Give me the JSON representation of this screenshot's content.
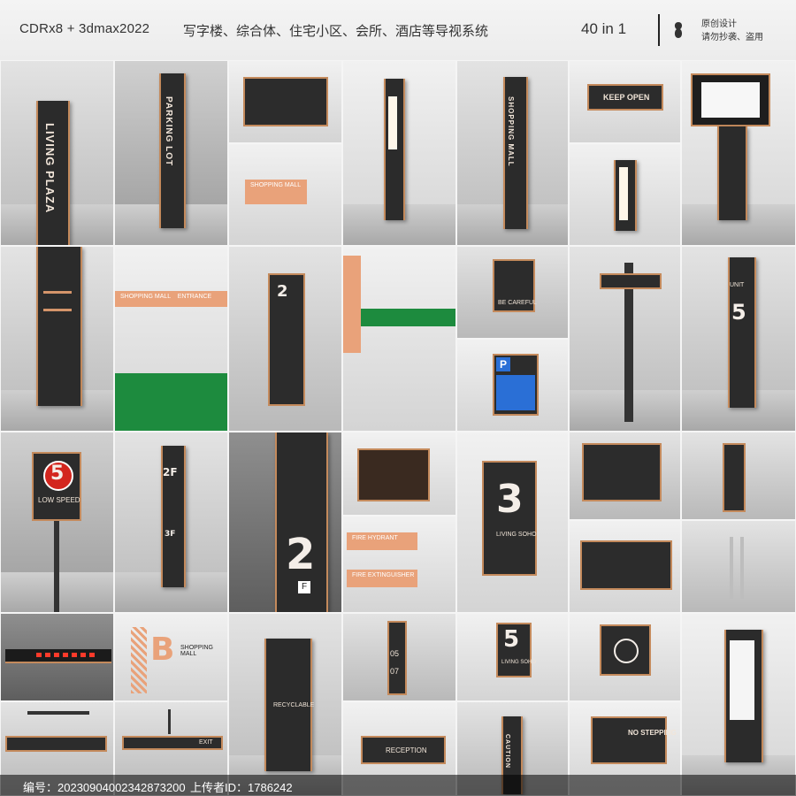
{
  "header": {
    "software": "CDRx8 + 3dmax2022",
    "title": "写字楼、综合体、住宅小区、会所、酒店等导视系统",
    "count": "40 in 1",
    "note_line1": "原创设计",
    "note_line2": "请勿抄袭、盗用"
  },
  "tiles": {
    "living_plaza": "LIVING PLAZA",
    "parking_lot": "PARKING LOT",
    "shopping_mall_v": "SHOPPING MALL",
    "keep_open": "KEEP OPEN",
    "shopping_mall_wall": "SHOPPING MALL",
    "floor_2": "2",
    "be_careful": "BE CAREFUL",
    "parking_p": "P",
    "unit_5": "5",
    "unit_label": "UNIT",
    "speed_5": "5",
    "low_speed": "LOW SPEED",
    "floor_2f": "2F",
    "floor_3f": "3F",
    "floor_2_big": "2",
    "floor_f": "F",
    "fire_hydrant": "FIRE HYDRANT",
    "fire_extinguisher": "FIRE EXTINGUISHER",
    "living_soho_3": "3",
    "living_soho": "LIVING SOHO",
    "shopping_mall_b": "B",
    "shopping_mall_b_label": "SHOPPING MALL",
    "recyclable": "RECYCLABLE",
    "floor_05": "05",
    "floor_07": "07",
    "living_soho_5": "5",
    "living_soho_small": "LIVING SOHO",
    "exit": "EXIT",
    "reception": "RECEPTION",
    "caution": "CAUTION",
    "no_stepping": "NO STEPPING",
    "shopping_mall_banner": "SHOPPING MALL",
    "entrance": "ENTRANCE"
  },
  "footer": {
    "id": "编号：20230904002342873200",
    "uploader": "上传者ID：1786242"
  },
  "colors": {
    "accent": "#c48a5c",
    "dark_panel": "#2b2b2b",
    "sign_orange": "#e9a27a",
    "speed_red": "#d3261e"
  }
}
